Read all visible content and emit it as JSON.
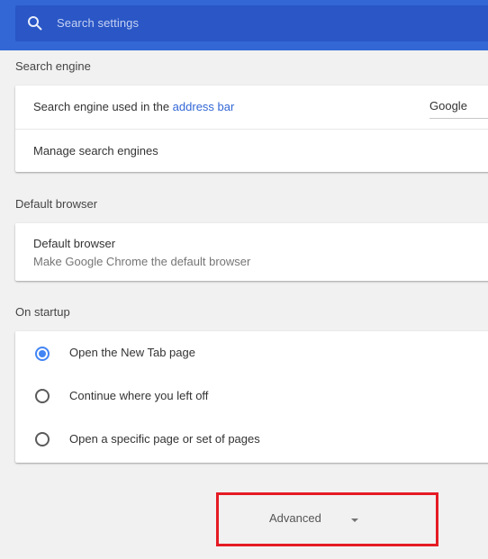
{
  "search": {
    "placeholder": "Search settings"
  },
  "sections": {
    "search_engine": {
      "title": "Search engine",
      "row1_text": "Search engine used in the ",
      "row1_link": "address bar",
      "selected_engine": "Google",
      "row2_text": "Manage search engines"
    },
    "default_browser": {
      "title": "Default browser",
      "row_title": "Default browser",
      "row_sub": "Make Google Chrome the default browser"
    },
    "on_startup": {
      "title": "On startup",
      "options": [
        {
          "label": "Open the New Tab page",
          "checked": true
        },
        {
          "label": "Continue where you left off",
          "checked": false
        },
        {
          "label": "Open a specific page or set of pages",
          "checked": false
        }
      ]
    }
  },
  "advanced": {
    "label": "Advanced"
  },
  "colors": {
    "header": "#3367d6",
    "search_box": "#2a56c6",
    "accent": "#4285f4",
    "highlight": "#e51b24"
  }
}
